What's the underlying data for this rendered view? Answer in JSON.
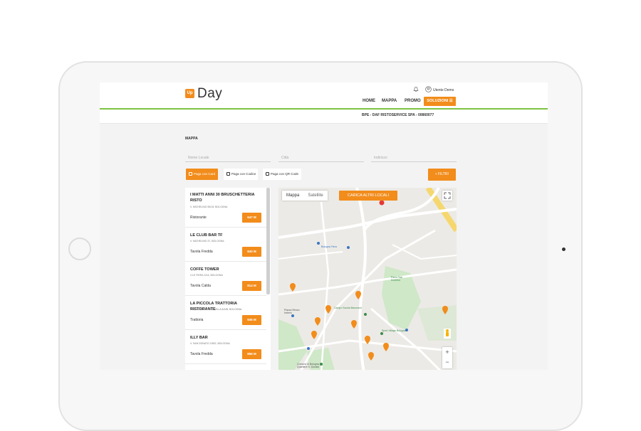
{
  "header": {
    "logo_badge": "Up",
    "logo_text": "Day",
    "user_name": "Utente Demo",
    "nav": [
      "HOME",
      "MAPPA",
      "PROMO"
    ],
    "solutions_label": "SOLUZIONI ☰"
  },
  "subheader": {
    "company": "BPE - DAF RISTOSERVICE SPA - 00860077"
  },
  "page": {
    "title": "MAPPA"
  },
  "filters": {
    "name_placeholder": "Nome Locale",
    "city_placeholder": "Città",
    "address_placeholder": "Indirizzo",
    "pay_card": "Paga con Card",
    "pay_code": "Paga con Codice",
    "pay_qr": "Paga con QR Code",
    "filter_label": "FILTRI"
  },
  "venues": [
    {
      "name": "I MATTI ANNI 30 BRUSCHETTERIA RISTO",
      "address": "V. MICHELINO 55/15, BOLOGNA",
      "type": "Ristorante",
      "distance": "647 M"
    },
    {
      "name": "LE CLUB BAR TF",
      "address": "V. MICHELINO 37, BOLOGNA",
      "type": "Tavola Fredda",
      "distance": "840 M"
    },
    {
      "name": "COFFE TOWER",
      "address": "V.LE FIERA 12/A, BOLOGNA",
      "type": "Tavola Calda",
      "distance": "814 M"
    },
    {
      "name": "LA PICCOLA TRATTORIA RISTORANTE",
      "address": "V. EDOARDO FERRAVILLA 8/A/B, BOLOGNA",
      "type": "Trattoria",
      "distance": "936 M"
    },
    {
      "name": "ILLY BAR",
      "address": "V. SAN DONATO 155/2, BOLOGNA",
      "type": "Tavola Fredda",
      "distance": "856 M"
    }
  ],
  "map": {
    "tab_map": "Mappa",
    "tab_satellite": "Satellite",
    "load_more": "CARICA ALTRI LOCALI",
    "labels": {
      "fiera": "Bologna Fiera",
      "park": "Parco San Donnino",
      "school": "Campo Scuola Baumann",
      "sport": "Sport Village Bologna",
      "square": "Piazza Renzo Imbeni",
      "comune": "Comune di Bologna Quartiere S. Donato"
    },
    "zoom_in": "+",
    "zoom_out": "−"
  },
  "colors": {
    "accent": "#f28c1b",
    "green_line": "#7cc242"
  }
}
